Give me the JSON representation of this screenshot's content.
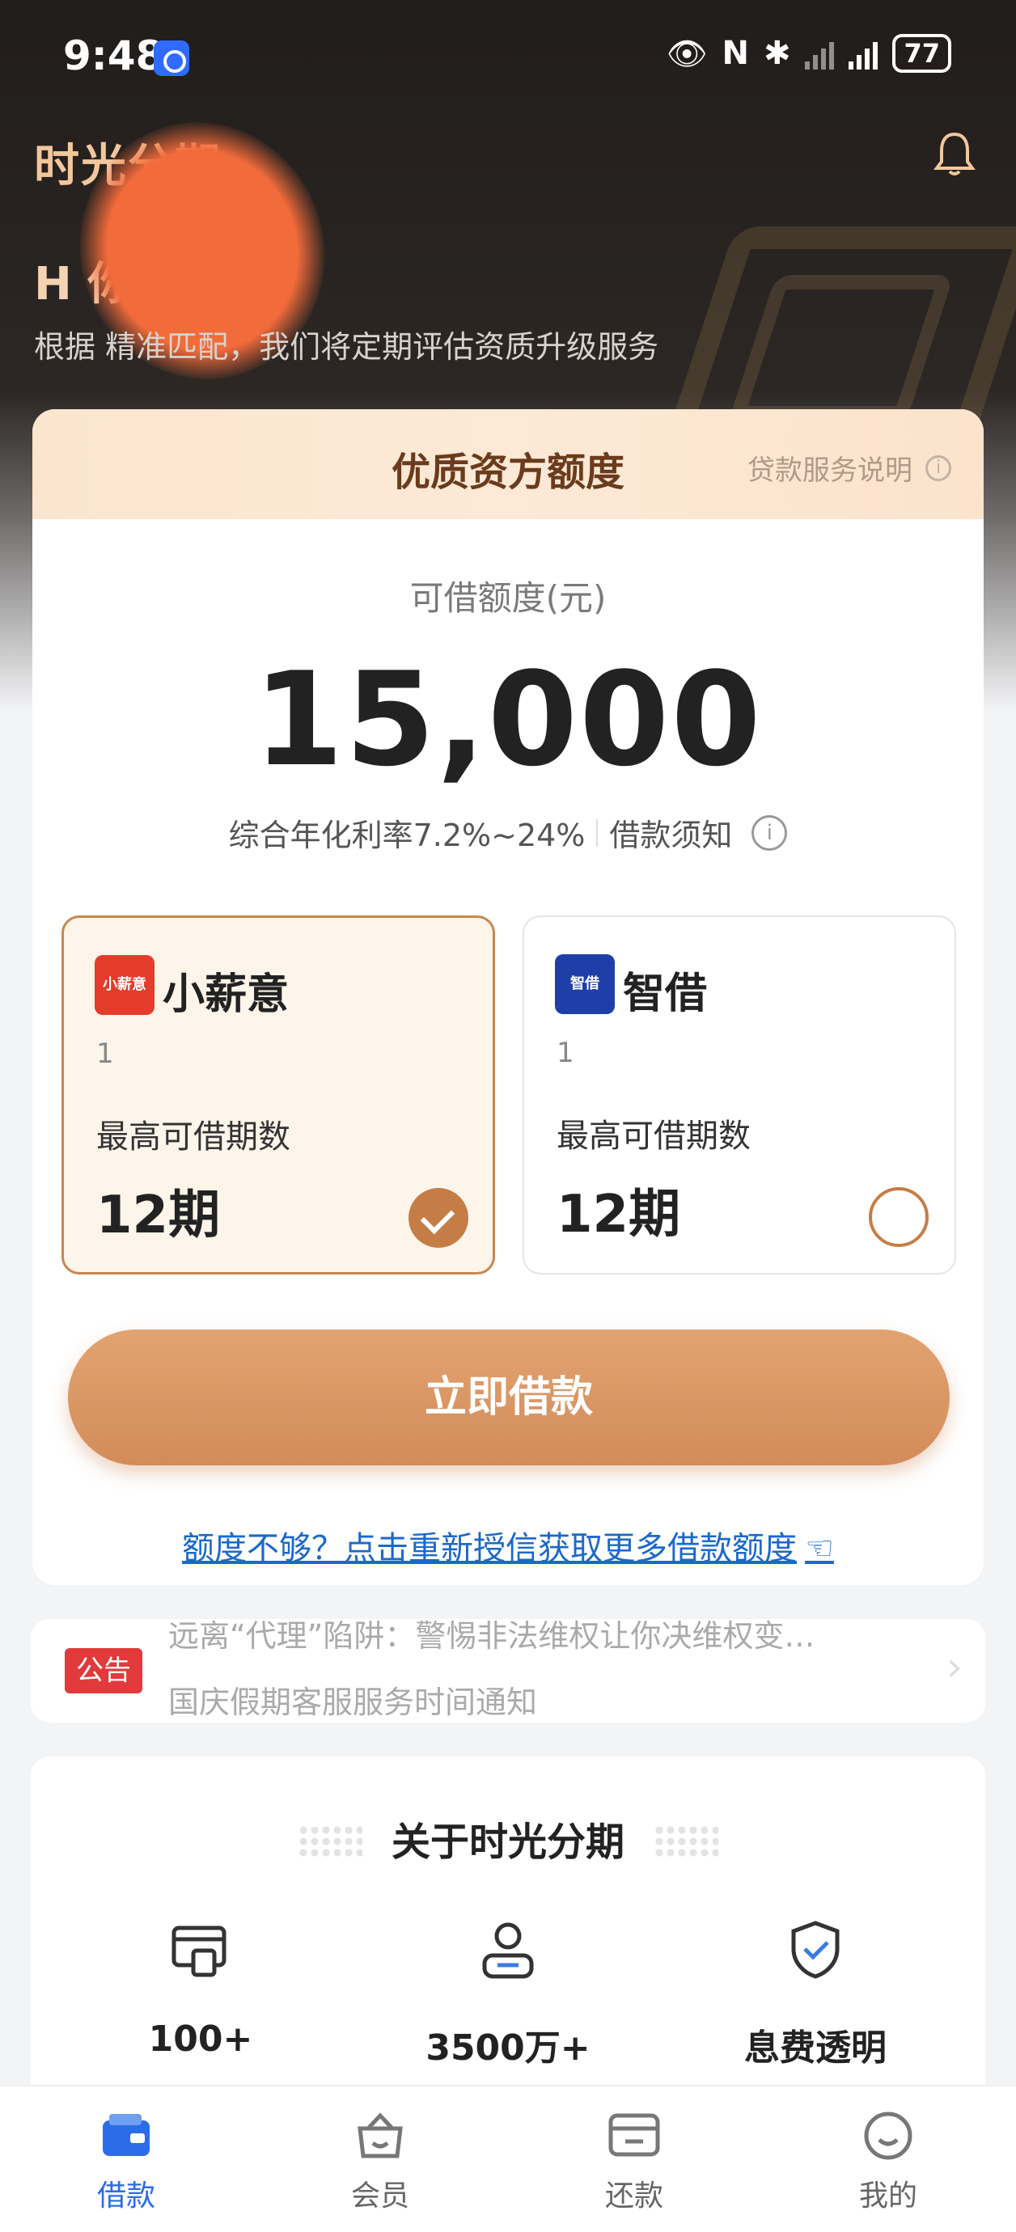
{
  "status_bar": {
    "time": "9:48",
    "battery": "77"
  },
  "header": {
    "brand": "时光分期",
    "greeting": "H 你可以借",
    "subtitle": "根据 精准匹配，我们将定期评估资质升级服务"
  },
  "card": {
    "title": "优质资方额度",
    "help_label": "贷款服务说明",
    "amount_label": "可借额度(元)",
    "amount": "15,000",
    "rate_text": "综合年化利率7.2%~24%",
    "loan_notice": "借款须知",
    "options": [
      {
        "logo_text": "小薪意",
        "name": "小薪意",
        "small": "1",
        "periods_label": "最高可借期数",
        "periods": "12期",
        "selected": true
      },
      {
        "logo_text": "智借",
        "name": "智借",
        "small": "1",
        "periods_label": "最高可借期数",
        "periods": "12期",
        "selected": false
      }
    ],
    "cta": "立即借款",
    "more_link": "额度不够？点击重新授信获取更多借款额度"
  },
  "notice": {
    "badge": "公告",
    "line1": "远离“代理”陷阱：警惕非法维权让你决维权变…",
    "line2": "国庆假期客服服务时间通知"
  },
  "about": {
    "title": "关于时光分期",
    "features": [
      {
        "icon": "card-icon",
        "value": "100+"
      },
      {
        "icon": "user-icon",
        "value": "3500万+"
      },
      {
        "icon": "shield-check-icon",
        "value": "息费透明"
      }
    ]
  },
  "nav": {
    "items": [
      {
        "label": "借款",
        "active": true
      },
      {
        "label": "会员",
        "active": false
      },
      {
        "label": "还款",
        "active": false
      },
      {
        "label": "我的",
        "active": false
      }
    ]
  },
  "colors": {
    "accent": "#c57d47",
    "link": "#1c69c9",
    "nav_active": "#2b6de8"
  }
}
